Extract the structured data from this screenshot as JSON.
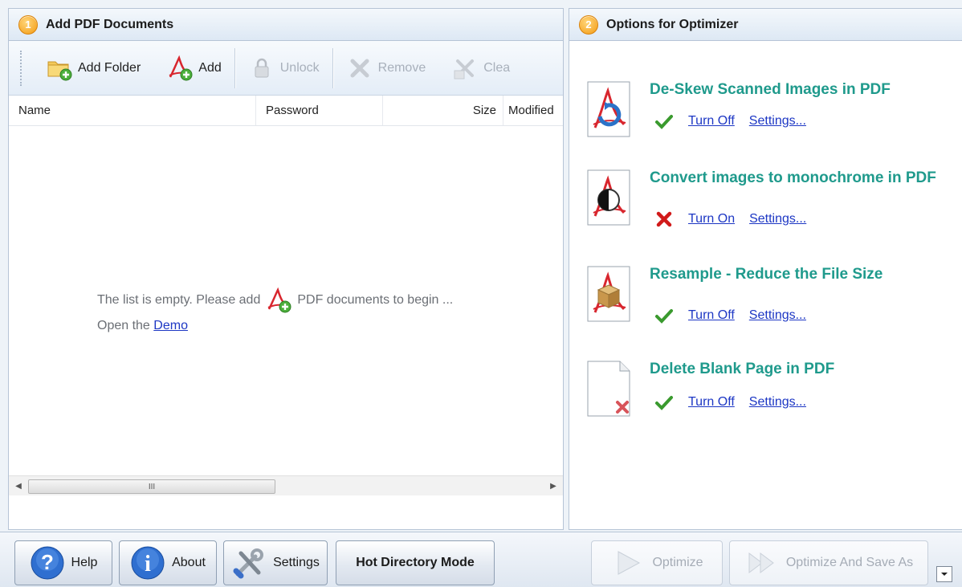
{
  "left_panel": {
    "step": "1",
    "title": "Add PDF Documents",
    "toolbar": {
      "add_folder": "Add Folder",
      "add": "Add",
      "unlock": "Unlock",
      "remove": "Remove",
      "clear": "Clea"
    },
    "columns": {
      "name": "Name",
      "password": "Password",
      "size": "Size",
      "modified": "Modified"
    },
    "empty_message_before": "The list is empty. Please add",
    "empty_message_after": "PDF documents to begin ...",
    "open_the": "Open the",
    "demo_link": "Demo",
    "scroll_thumb_mark": "III"
  },
  "right_panel": {
    "step": "2",
    "title": "Options for Optimizer",
    "options": [
      {
        "title": "De-Skew Scanned Images in PDF",
        "enabled": true,
        "toggle": "Turn Off",
        "settings": "Settings..."
      },
      {
        "title": "Convert images to monochrome in PDF",
        "enabled": false,
        "toggle": "Turn On",
        "settings": "Settings..."
      },
      {
        "title": "Resample - Reduce the File Size",
        "enabled": true,
        "toggle": "Turn Off",
        "settings": "Settings..."
      },
      {
        "title": "Delete Blank Page in PDF",
        "enabled": true,
        "toggle": "Turn Off",
        "settings": "Settings..."
      }
    ]
  },
  "bottom_bar": {
    "help": "Help",
    "about": "About",
    "settings": "Settings",
    "hot_directory": "Hot Directory Mode",
    "optimize": "Optimize",
    "optimize_save_as": "Optimize And Save As"
  },
  "colors": {
    "option_title": "#1f9a8c",
    "link": "#1d37c4",
    "check": "#3a9a2e",
    "cross": "#d11a1a",
    "badge": "#f39a12"
  }
}
